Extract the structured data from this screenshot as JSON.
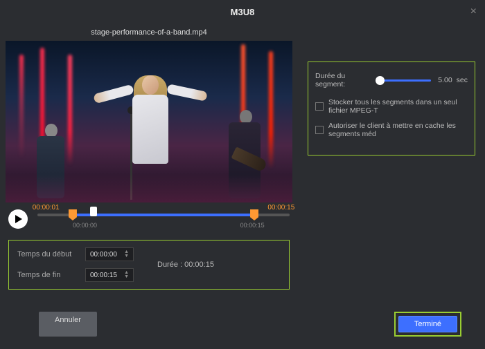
{
  "dialog": {
    "title": "M3U8",
    "close": "×"
  },
  "file": {
    "name": "stage-performance-of-a-band.mp4"
  },
  "player": {
    "range_start": "00:00:01",
    "range_end": "00:00:15",
    "scale_start": "00:00:00",
    "scale_end": "00:00:15"
  },
  "trim": {
    "start_label": "Temps du début",
    "start_value": "00:00:00",
    "end_label": "Temps de fin",
    "end_value": "00:00:15",
    "duration_label": "Durée :",
    "duration_value": "00:00:15"
  },
  "settings": {
    "segment_label": "Durée du segment:",
    "segment_value": "5.00",
    "segment_unit": "sec",
    "store_single_label": "Stocker tous les segments dans un seul fichier MPEG-T",
    "allow_cache_label": "Autoriser le client à mettre en cache les segments méd"
  },
  "footer": {
    "cancel": "Annuler",
    "done": "Terminé"
  }
}
